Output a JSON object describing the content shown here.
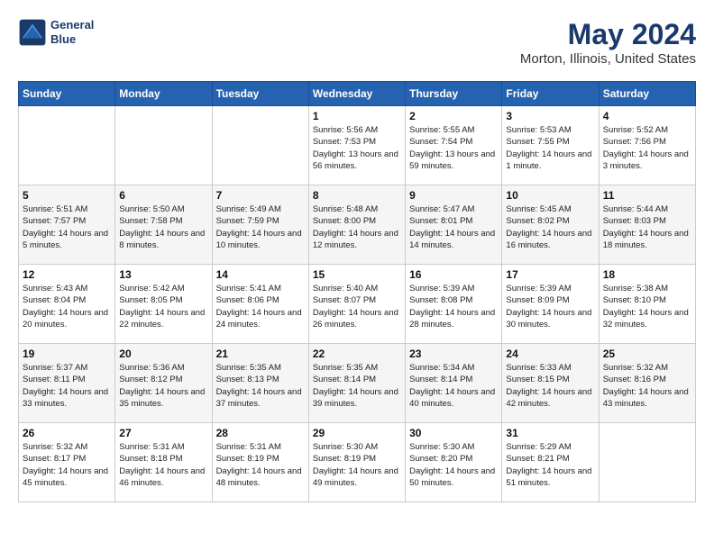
{
  "header": {
    "logo_line1": "General",
    "logo_line2": "Blue",
    "title": "May 2024",
    "subtitle": "Morton, Illinois, United States"
  },
  "days_of_week": [
    "Sunday",
    "Monday",
    "Tuesday",
    "Wednesday",
    "Thursday",
    "Friday",
    "Saturday"
  ],
  "weeks": [
    [
      {
        "day": "",
        "info": ""
      },
      {
        "day": "",
        "info": ""
      },
      {
        "day": "",
        "info": ""
      },
      {
        "day": "1",
        "info": "Sunrise: 5:56 AM\nSunset: 7:53 PM\nDaylight: 13 hours\nand 56 minutes."
      },
      {
        "day": "2",
        "info": "Sunrise: 5:55 AM\nSunset: 7:54 PM\nDaylight: 13 hours\nand 59 minutes."
      },
      {
        "day": "3",
        "info": "Sunrise: 5:53 AM\nSunset: 7:55 PM\nDaylight: 14 hours\nand 1 minute."
      },
      {
        "day": "4",
        "info": "Sunrise: 5:52 AM\nSunset: 7:56 PM\nDaylight: 14 hours\nand 3 minutes."
      }
    ],
    [
      {
        "day": "5",
        "info": "Sunrise: 5:51 AM\nSunset: 7:57 PM\nDaylight: 14 hours\nand 5 minutes."
      },
      {
        "day": "6",
        "info": "Sunrise: 5:50 AM\nSunset: 7:58 PM\nDaylight: 14 hours\nand 8 minutes."
      },
      {
        "day": "7",
        "info": "Sunrise: 5:49 AM\nSunset: 7:59 PM\nDaylight: 14 hours\nand 10 minutes."
      },
      {
        "day": "8",
        "info": "Sunrise: 5:48 AM\nSunset: 8:00 PM\nDaylight: 14 hours\nand 12 minutes."
      },
      {
        "day": "9",
        "info": "Sunrise: 5:47 AM\nSunset: 8:01 PM\nDaylight: 14 hours\nand 14 minutes."
      },
      {
        "day": "10",
        "info": "Sunrise: 5:45 AM\nSunset: 8:02 PM\nDaylight: 14 hours\nand 16 minutes."
      },
      {
        "day": "11",
        "info": "Sunrise: 5:44 AM\nSunset: 8:03 PM\nDaylight: 14 hours\nand 18 minutes."
      }
    ],
    [
      {
        "day": "12",
        "info": "Sunrise: 5:43 AM\nSunset: 8:04 PM\nDaylight: 14 hours\nand 20 minutes."
      },
      {
        "day": "13",
        "info": "Sunrise: 5:42 AM\nSunset: 8:05 PM\nDaylight: 14 hours\nand 22 minutes."
      },
      {
        "day": "14",
        "info": "Sunrise: 5:41 AM\nSunset: 8:06 PM\nDaylight: 14 hours\nand 24 minutes."
      },
      {
        "day": "15",
        "info": "Sunrise: 5:40 AM\nSunset: 8:07 PM\nDaylight: 14 hours\nand 26 minutes."
      },
      {
        "day": "16",
        "info": "Sunrise: 5:39 AM\nSunset: 8:08 PM\nDaylight: 14 hours\nand 28 minutes."
      },
      {
        "day": "17",
        "info": "Sunrise: 5:39 AM\nSunset: 8:09 PM\nDaylight: 14 hours\nand 30 minutes."
      },
      {
        "day": "18",
        "info": "Sunrise: 5:38 AM\nSunset: 8:10 PM\nDaylight: 14 hours\nand 32 minutes."
      }
    ],
    [
      {
        "day": "19",
        "info": "Sunrise: 5:37 AM\nSunset: 8:11 PM\nDaylight: 14 hours\nand 33 minutes."
      },
      {
        "day": "20",
        "info": "Sunrise: 5:36 AM\nSunset: 8:12 PM\nDaylight: 14 hours\nand 35 minutes."
      },
      {
        "day": "21",
        "info": "Sunrise: 5:35 AM\nSunset: 8:13 PM\nDaylight: 14 hours\nand 37 minutes."
      },
      {
        "day": "22",
        "info": "Sunrise: 5:35 AM\nSunset: 8:14 PM\nDaylight: 14 hours\nand 39 minutes."
      },
      {
        "day": "23",
        "info": "Sunrise: 5:34 AM\nSunset: 8:14 PM\nDaylight: 14 hours\nand 40 minutes."
      },
      {
        "day": "24",
        "info": "Sunrise: 5:33 AM\nSunset: 8:15 PM\nDaylight: 14 hours\nand 42 minutes."
      },
      {
        "day": "25",
        "info": "Sunrise: 5:32 AM\nSunset: 8:16 PM\nDaylight: 14 hours\nand 43 minutes."
      }
    ],
    [
      {
        "day": "26",
        "info": "Sunrise: 5:32 AM\nSunset: 8:17 PM\nDaylight: 14 hours\nand 45 minutes."
      },
      {
        "day": "27",
        "info": "Sunrise: 5:31 AM\nSunset: 8:18 PM\nDaylight: 14 hours\nand 46 minutes."
      },
      {
        "day": "28",
        "info": "Sunrise: 5:31 AM\nSunset: 8:19 PM\nDaylight: 14 hours\nand 48 minutes."
      },
      {
        "day": "29",
        "info": "Sunrise: 5:30 AM\nSunset: 8:19 PM\nDaylight: 14 hours\nand 49 minutes."
      },
      {
        "day": "30",
        "info": "Sunrise: 5:30 AM\nSunset: 8:20 PM\nDaylight: 14 hours\nand 50 minutes."
      },
      {
        "day": "31",
        "info": "Sunrise: 5:29 AM\nSunset: 8:21 PM\nDaylight: 14 hours\nand 51 minutes."
      },
      {
        "day": "",
        "info": ""
      }
    ]
  ]
}
